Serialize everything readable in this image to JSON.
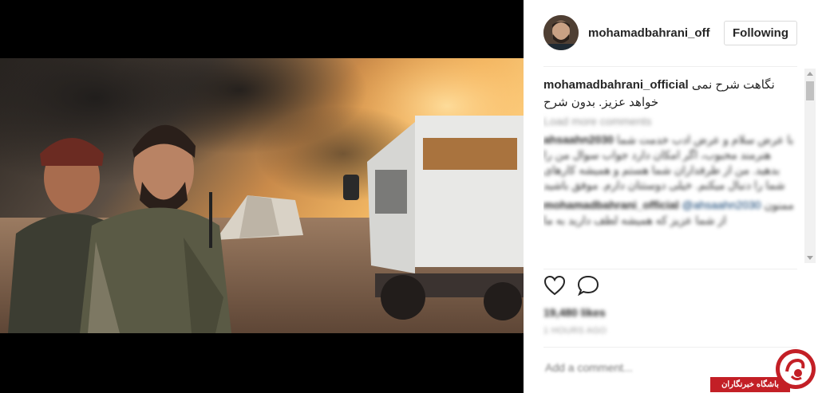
{
  "post": {
    "username": "mohamadbahrani_off",
    "follow_label": "Following",
    "caption_user": "mohamadbahrani_official",
    "caption_text": "نگاهت شرح نمی خواهد عزیز. بدون شرح",
    "load_more": "Load more comments",
    "comments": [
      {
        "user": "ahsaahn2030",
        "text": "با عرض سلام و عرض ادب خدمت شما هنرمند محبوب، اگر امکان دارد جواب سوال من را بدهید. من از طرفداران شما هستم و همیشه کارهای شما را دنبال میکنم. خیلی دوستتان دارم. موفق باشید"
      },
      {
        "user": "mohamadbahrani_official",
        "mention": "@ahsaahn2030",
        "text": "ممنون از شما عزیز که همیشه لطف دارید به ما"
      }
    ],
    "likes": "19,480 likes",
    "time": "1 hours ago",
    "add_comment_placeholder": "Add a comment..."
  },
  "watermark": {
    "text": "باشگاه خبرنگاران"
  },
  "colors": {
    "watermark_red": "#c31f26",
    "mention_blue": "#003569"
  }
}
